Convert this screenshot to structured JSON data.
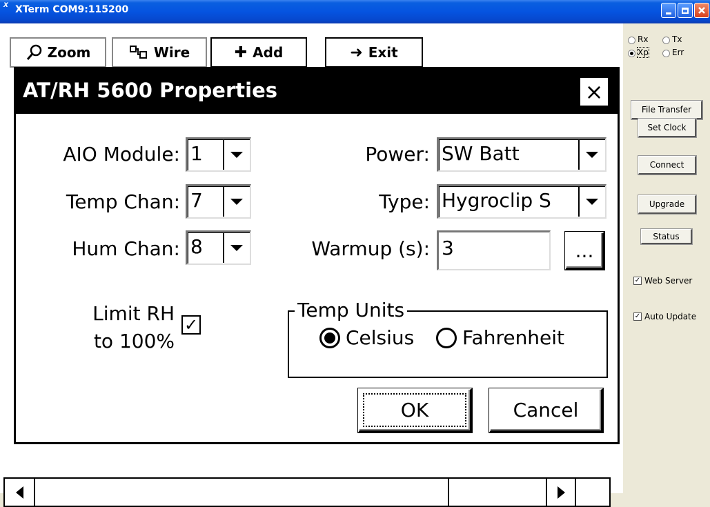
{
  "window": {
    "title": "XTerm COM9:115200",
    "app_icon_text": "X",
    "app_icon_sup": "ᵐ"
  },
  "toolbar": {
    "zoom_label": "Zoom",
    "wire_label": "Wire",
    "add_label": "Add",
    "exit_label": "Exit"
  },
  "dialog": {
    "title": "AT/RH 5600 Properties",
    "close_glyph": "×",
    "aio_module_label": "AIO Module:",
    "aio_module_value": "1",
    "temp_chan_label": "Temp Chan:",
    "temp_chan_value": "7",
    "hum_chan_label": "Hum Chan:",
    "hum_chan_value": "8",
    "power_label": "Power:",
    "power_value": "SW Batt",
    "type_label": "Type:",
    "type_value": "Hygroclip S",
    "warmup_label": "Warmup (s):",
    "warmup_value": "3",
    "ellipsis_label": "...",
    "limit_rh_line1": "Limit RH",
    "limit_rh_line2": "to 100%",
    "limit_rh_checked": true,
    "check_glyph": "✓",
    "temp_units_label": "Temp Units",
    "celsius_label": "Celsius",
    "fahrenheit_label": "Fahrenheit",
    "temp_units_selected": "Celsius",
    "ok_label": "OK",
    "cancel_label": "Cancel"
  },
  "side_panel": {
    "radio_rx": "Rx",
    "radio_tx": "Tx",
    "radio_xp": "Xp",
    "radio_err": "Err",
    "selected_radio": "Xp",
    "file_transfer_label": "File Transfer",
    "set_clock_label": "Set Clock",
    "connect_label": "Connect",
    "upgrade_label": "Upgrade",
    "status_label": "Status",
    "web_server_label": "Web Server",
    "web_server_checked": true,
    "auto_update_label": "Auto Update",
    "auto_update_checked": true,
    "check_glyph": "✓"
  },
  "colors": {
    "titlebar": "#0554e0",
    "panel": "#ece9d8",
    "dialog_title_bg": "#000000"
  }
}
